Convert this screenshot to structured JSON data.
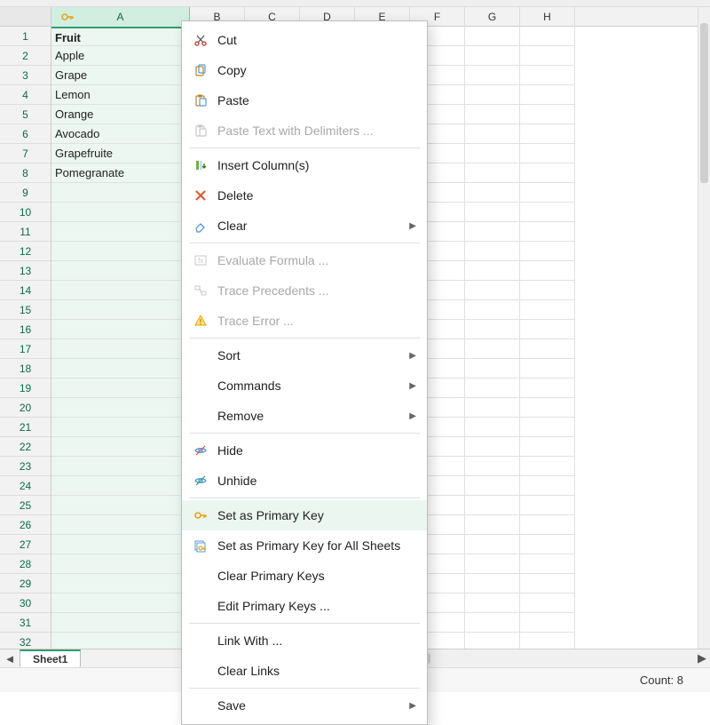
{
  "columns": [
    "A",
    "B",
    "C",
    "D",
    "E",
    "F",
    "G",
    "H"
  ],
  "row_numbers": [
    1,
    2,
    3,
    4,
    5,
    6,
    7,
    8,
    9,
    10,
    11,
    12,
    13,
    14,
    15,
    16,
    17,
    18,
    19,
    20,
    21,
    22,
    23,
    24,
    25,
    26,
    27,
    28,
    29,
    30,
    31,
    32
  ],
  "columnA_values": [
    "Fruit",
    "Apple",
    "Grape",
    "Lemon",
    "Orange",
    "Avocado",
    "Grapefruite",
    "Pomegranate"
  ],
  "sheet_tab": "Sheet1",
  "status_count_label": "Count: 8",
  "menu": {
    "cut": "Cut",
    "copy": "Copy",
    "paste": "Paste",
    "paste_delim": "Paste Text with Delimiters ...",
    "insert_cols": "Insert Column(s)",
    "delete": "Delete",
    "clear": "Clear",
    "eval_formula": "Evaluate Formula ...",
    "trace_prec": "Trace Precedents ...",
    "trace_err": "Trace Error ...",
    "sort": "Sort",
    "commands": "Commands",
    "remove": "Remove",
    "hide": "Hide",
    "unhide": "Unhide",
    "set_pk": "Set as Primary Key",
    "set_pk_all": "Set as Primary Key for All Sheets",
    "clear_pk": "Clear Primary Keys",
    "edit_pk": "Edit Primary Keys ...",
    "link_with": "Link With ...",
    "clear_links": "Clear Links",
    "save": "Save"
  }
}
